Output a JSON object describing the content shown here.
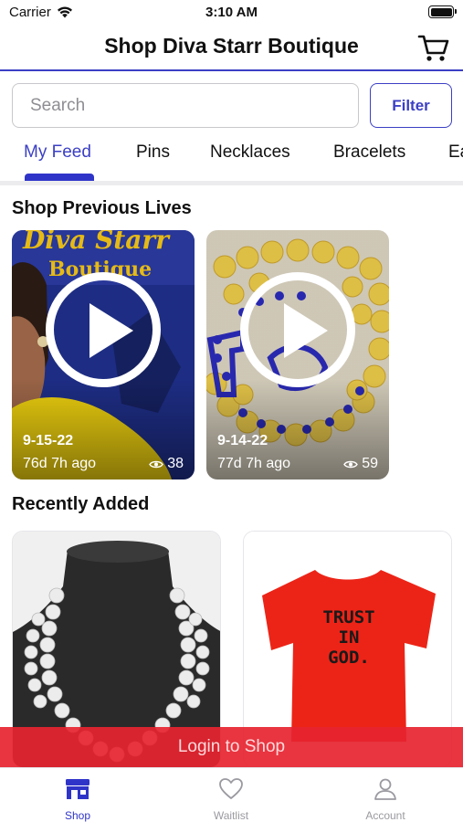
{
  "status_bar": {
    "carrier": "Carrier",
    "time": "3:10 AM"
  },
  "header": {
    "title": "Shop Diva Starr Boutique",
    "cart_icon": "cart-icon"
  },
  "search": {
    "placeholder": "Search",
    "value": ""
  },
  "filter": {
    "label": "Filter"
  },
  "tabs": [
    {
      "label": "My Feed",
      "active": true
    },
    {
      "label": "Pins"
    },
    {
      "label": "Necklaces"
    },
    {
      "label": "Bracelets"
    },
    {
      "label": "Ea"
    }
  ],
  "previous_lives": {
    "title": "Shop Previous Lives",
    "items": [
      {
        "date": "9-15-22",
        "ago": "76d 7h ago",
        "views": "38",
        "thumb_logo": "Diva Starr Boutique"
      },
      {
        "date": "9-14-22",
        "ago": "77d 7h ago",
        "views": "59"
      }
    ]
  },
  "recently_added": {
    "title": "Recently Added",
    "items": [
      {
        "image": "pearl-necklace-image"
      },
      {
        "image": "red-tshirt-image",
        "shirt_text_line1": "TRUST",
        "shirt_text_line2": "IN",
        "shirt_text_line3": "GOD."
      }
    ]
  },
  "login_banner": {
    "label": "Login to Shop"
  },
  "bottom_nav": [
    {
      "label": "Shop",
      "icon": "store-icon",
      "active": true
    },
    {
      "label": "Waitlist",
      "icon": "heart-icon"
    },
    {
      "label": "Account",
      "icon": "person-icon"
    }
  ],
  "colors": {
    "accent": "#2f34c9",
    "banner": "#e62430"
  }
}
